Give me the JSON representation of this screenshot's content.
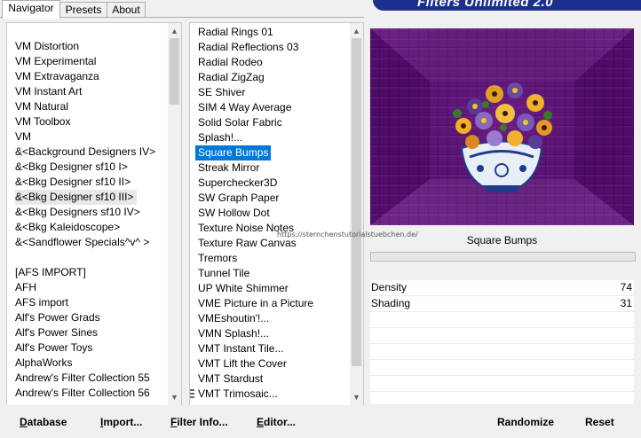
{
  "tabs": [
    {
      "label": "Navigator"
    },
    {
      "label": "Presets"
    },
    {
      "label": "About"
    }
  ],
  "banner": {
    "title": "Filters Unlimited 2.0"
  },
  "categories": [
    "VM Distortion",
    "VM Experimental",
    "VM Extravaganza",
    "VM Instant Art",
    "VM Natural",
    "VM Toolbox",
    "VM",
    "&<Background Designers IV>",
    "&<Bkg Designer sf10 I>",
    "&<Bkg Designer sf10 II>",
    "&<Bkg Designer sf10 III>",
    "&<Bkg Designers sf10 IV>",
    "&<Bkg Kaleidoscope>",
    "&<Sandflower Specials^v^ >",
    "",
    "[AFS IMPORT]",
    "AFH",
    "AFS import",
    "Alf's Power Grads",
    "Alf's Power Sines",
    "Alf's Power Toys",
    "AlphaWorks",
    "Andrew's Filter Collection 55",
    "Andrew's Filter Collection 56"
  ],
  "filters": [
    "Radial  Rings 01",
    "Radial Reflections 03",
    "Radial Rodeo",
    "Radial ZigZag",
    "SE Shiver",
    "SIM 4 Way Average",
    "Solid Solar Fabric",
    "Splash!...",
    "Square Bumps",
    "Streak Mirror",
    "Superchecker3D",
    "SW Graph Paper",
    "SW Hollow Dot",
    "Texture Noise Notes",
    "Texture Raw Canvas",
    "Tremors",
    "Tunnel Tile",
    "UP White Shimmer",
    "VME Picture in a Picture",
    "VMEshoutin'!...",
    "VMN Splash!...",
    "VMT Instant Tile...",
    "VMT Lift the Cover",
    "VMT Stardust",
    "VMT Trimosaic..."
  ],
  "selected_filter": "Square Bumps",
  "highlighted_category": "&<Bkg Designer sf10 III>",
  "preview": {
    "filter_name": "Square Bumps"
  },
  "params": [
    {
      "label": "Density",
      "value": "74"
    },
    {
      "label": "Shading",
      "value": "31"
    }
  ],
  "buttons": {
    "database": "Database",
    "import": "Import...",
    "filter_info": "Filter Info...",
    "editor": "Editor...",
    "randomize": "Randomize",
    "reset": "Reset"
  },
  "watermark": "https://sternchenstutorialstuebchen.de/",
  "colors": {
    "selection": "#0078d7",
    "banner": "#1c2f8f",
    "preview_bg": "#4a0560"
  }
}
